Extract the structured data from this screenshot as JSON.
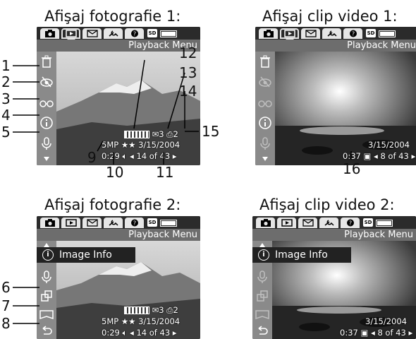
{
  "captions": {
    "photo1": "Afişaj fotografie 1:",
    "video1": "Afişaj clip video 1:",
    "photo2": "Afişaj fotografie 2:",
    "video2": "Afişaj clip video 2:"
  },
  "menu_title": "Playback Menu",
  "tabs": [
    "camera-icon",
    "playback-icon",
    "share-icon",
    "setup-icon",
    "help-icon"
  ],
  "sd_label": "SD",
  "image_info_label": "Image Info",
  "photo_overlay": {
    "count": "3",
    "prints": "2",
    "quality": "5MP ★★",
    "date": "3/15/2004",
    "audio_length": "0:29",
    "position": "◂ 14 of 43 ▸"
  },
  "video_overlay": {
    "date": "3/15/2004",
    "length": "0:37",
    "position": "◂ 8 of 43 ▸"
  },
  "callouts": [
    "1",
    "2",
    "3",
    "4",
    "5",
    "6",
    "7",
    "8",
    "9",
    "10",
    "11",
    "12",
    "13",
    "14",
    "15",
    "16"
  ],
  "side_icons_1": [
    "delete-icon",
    "remove-red-eyes-icon",
    "image-advice-icon",
    "image-info-icon",
    "record-audio-icon"
  ],
  "side_icons_2": [
    "image-info-icon",
    "record-audio-icon",
    "rotate-icon",
    "view-panorama-icon",
    "exit-icon"
  ]
}
